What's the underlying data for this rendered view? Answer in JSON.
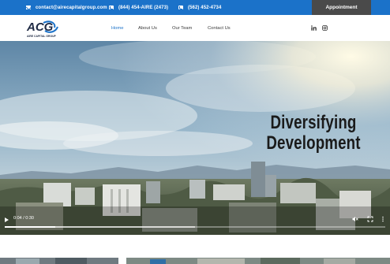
{
  "topbar": {
    "email": "contact@airecapitalgroup.com",
    "phone_primary": "(844) 454-AIRE (2473)",
    "phone_secondary": "(562) 452-4734",
    "appointment_label": "Appointment",
    "color": "#1b72c9"
  },
  "header": {
    "logo_mark": "ACG",
    "logo_text": "AIRE CAPITAL GROUP",
    "nav": [
      {
        "label": "Home",
        "active": true
      },
      {
        "label": "About Us",
        "active": false
      },
      {
        "label": "Our Team",
        "active": false
      },
      {
        "label": "Contact Us",
        "active": false
      }
    ],
    "social_icons": [
      "linkedin-icon",
      "instagram-icon"
    ]
  },
  "hero": {
    "headline_line1": "Diversifying",
    "headline_line2": "Development"
  },
  "video": {
    "time_display": "0:04 / 0:30",
    "progress": 0.133,
    "buffered": 0.5,
    "icons": [
      "play-icon",
      "mute-icon",
      "fullscreen-icon",
      "more-options-icon"
    ]
  }
}
